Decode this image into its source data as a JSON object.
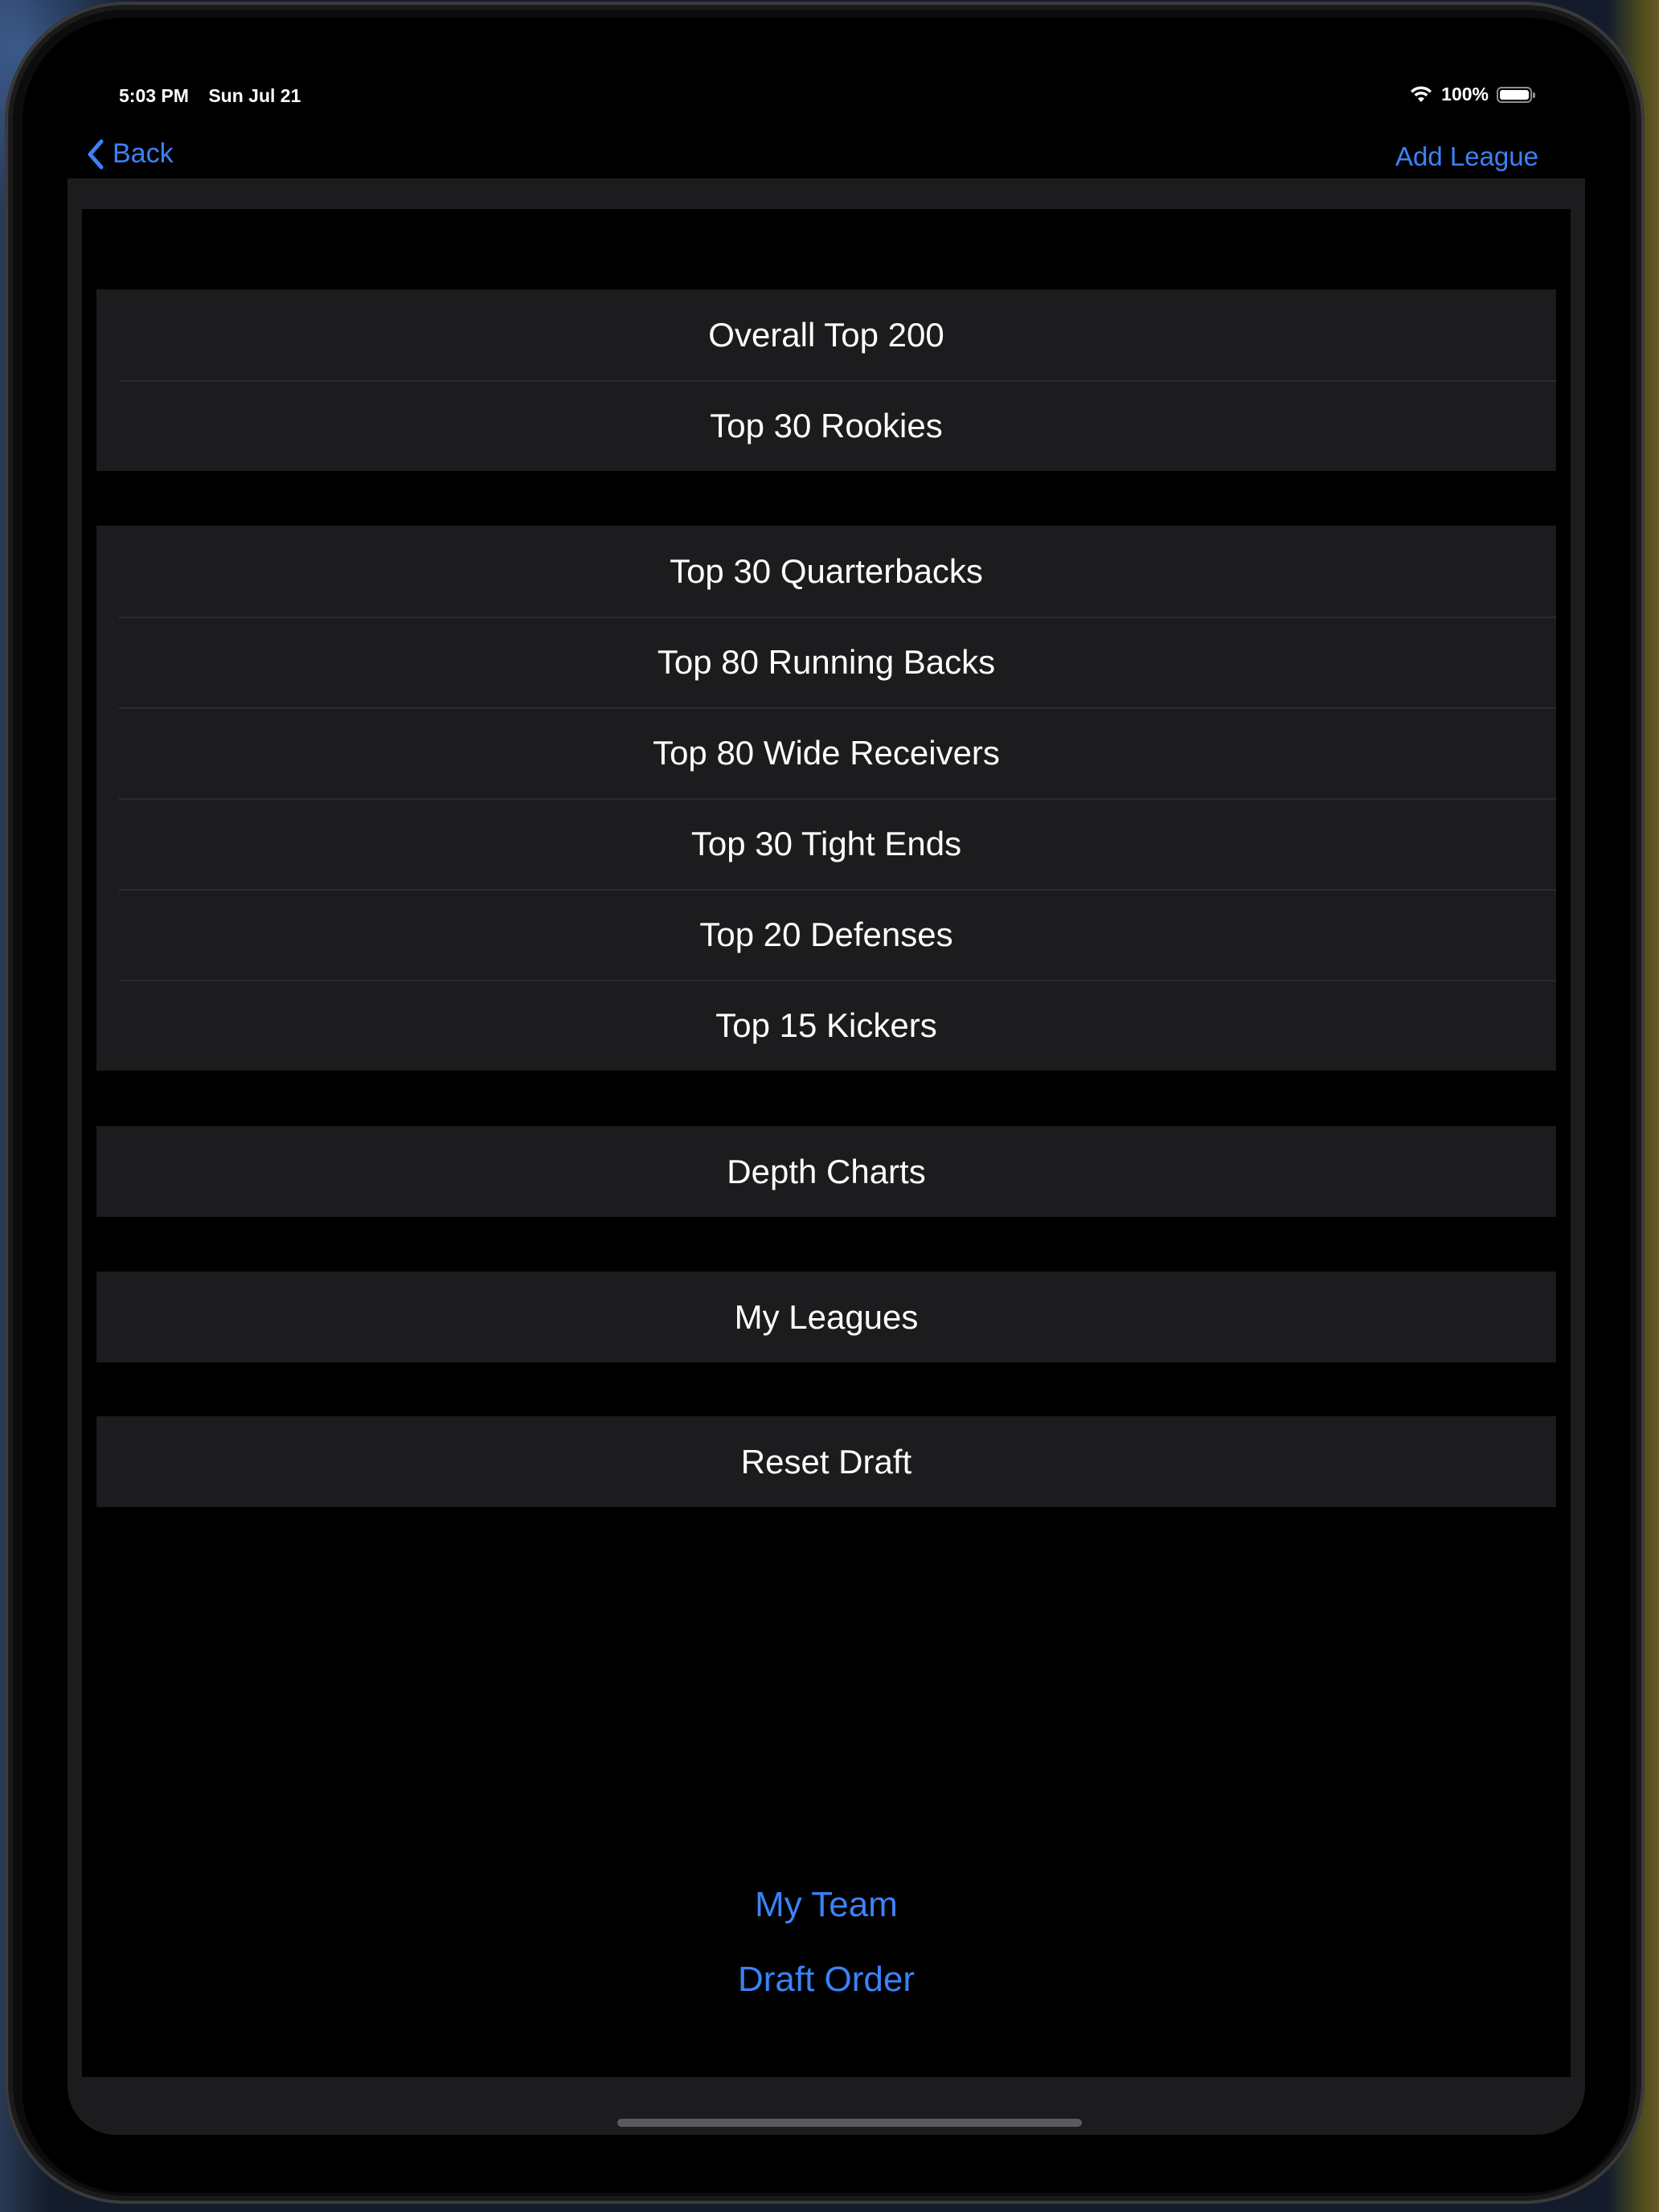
{
  "status_bar": {
    "time": "5:03 PM",
    "date": "Sun Jul 21",
    "battery_text": "100%",
    "battery_level": 1.0,
    "icons": [
      "wifi-icon",
      "battery-icon"
    ]
  },
  "nav": {
    "back_label": "Back",
    "add_label": "Add League"
  },
  "groups": [
    {
      "rows": [
        "Overall Top 200",
        "Top 30 Rookies"
      ]
    },
    {
      "rows": [
        "Top 30 Quarterbacks",
        "Top 80 Running Backs",
        "Top 80 Wide Receivers",
        "Top 30 Tight Ends",
        "Top 20 Defenses",
        "Top 15 Kickers"
      ]
    },
    {
      "rows": [
        "Depth Charts"
      ]
    },
    {
      "rows": [
        "My Leagues"
      ]
    },
    {
      "rows": [
        "Reset Draft"
      ]
    }
  ],
  "footer_links": {
    "my_team": "My Team",
    "draft_order": "Draft Order"
  },
  "colors": {
    "accent": "#3b82f6",
    "row_background": "#1c1c1e",
    "screen_background": "#000000",
    "text": "#ffffff"
  }
}
